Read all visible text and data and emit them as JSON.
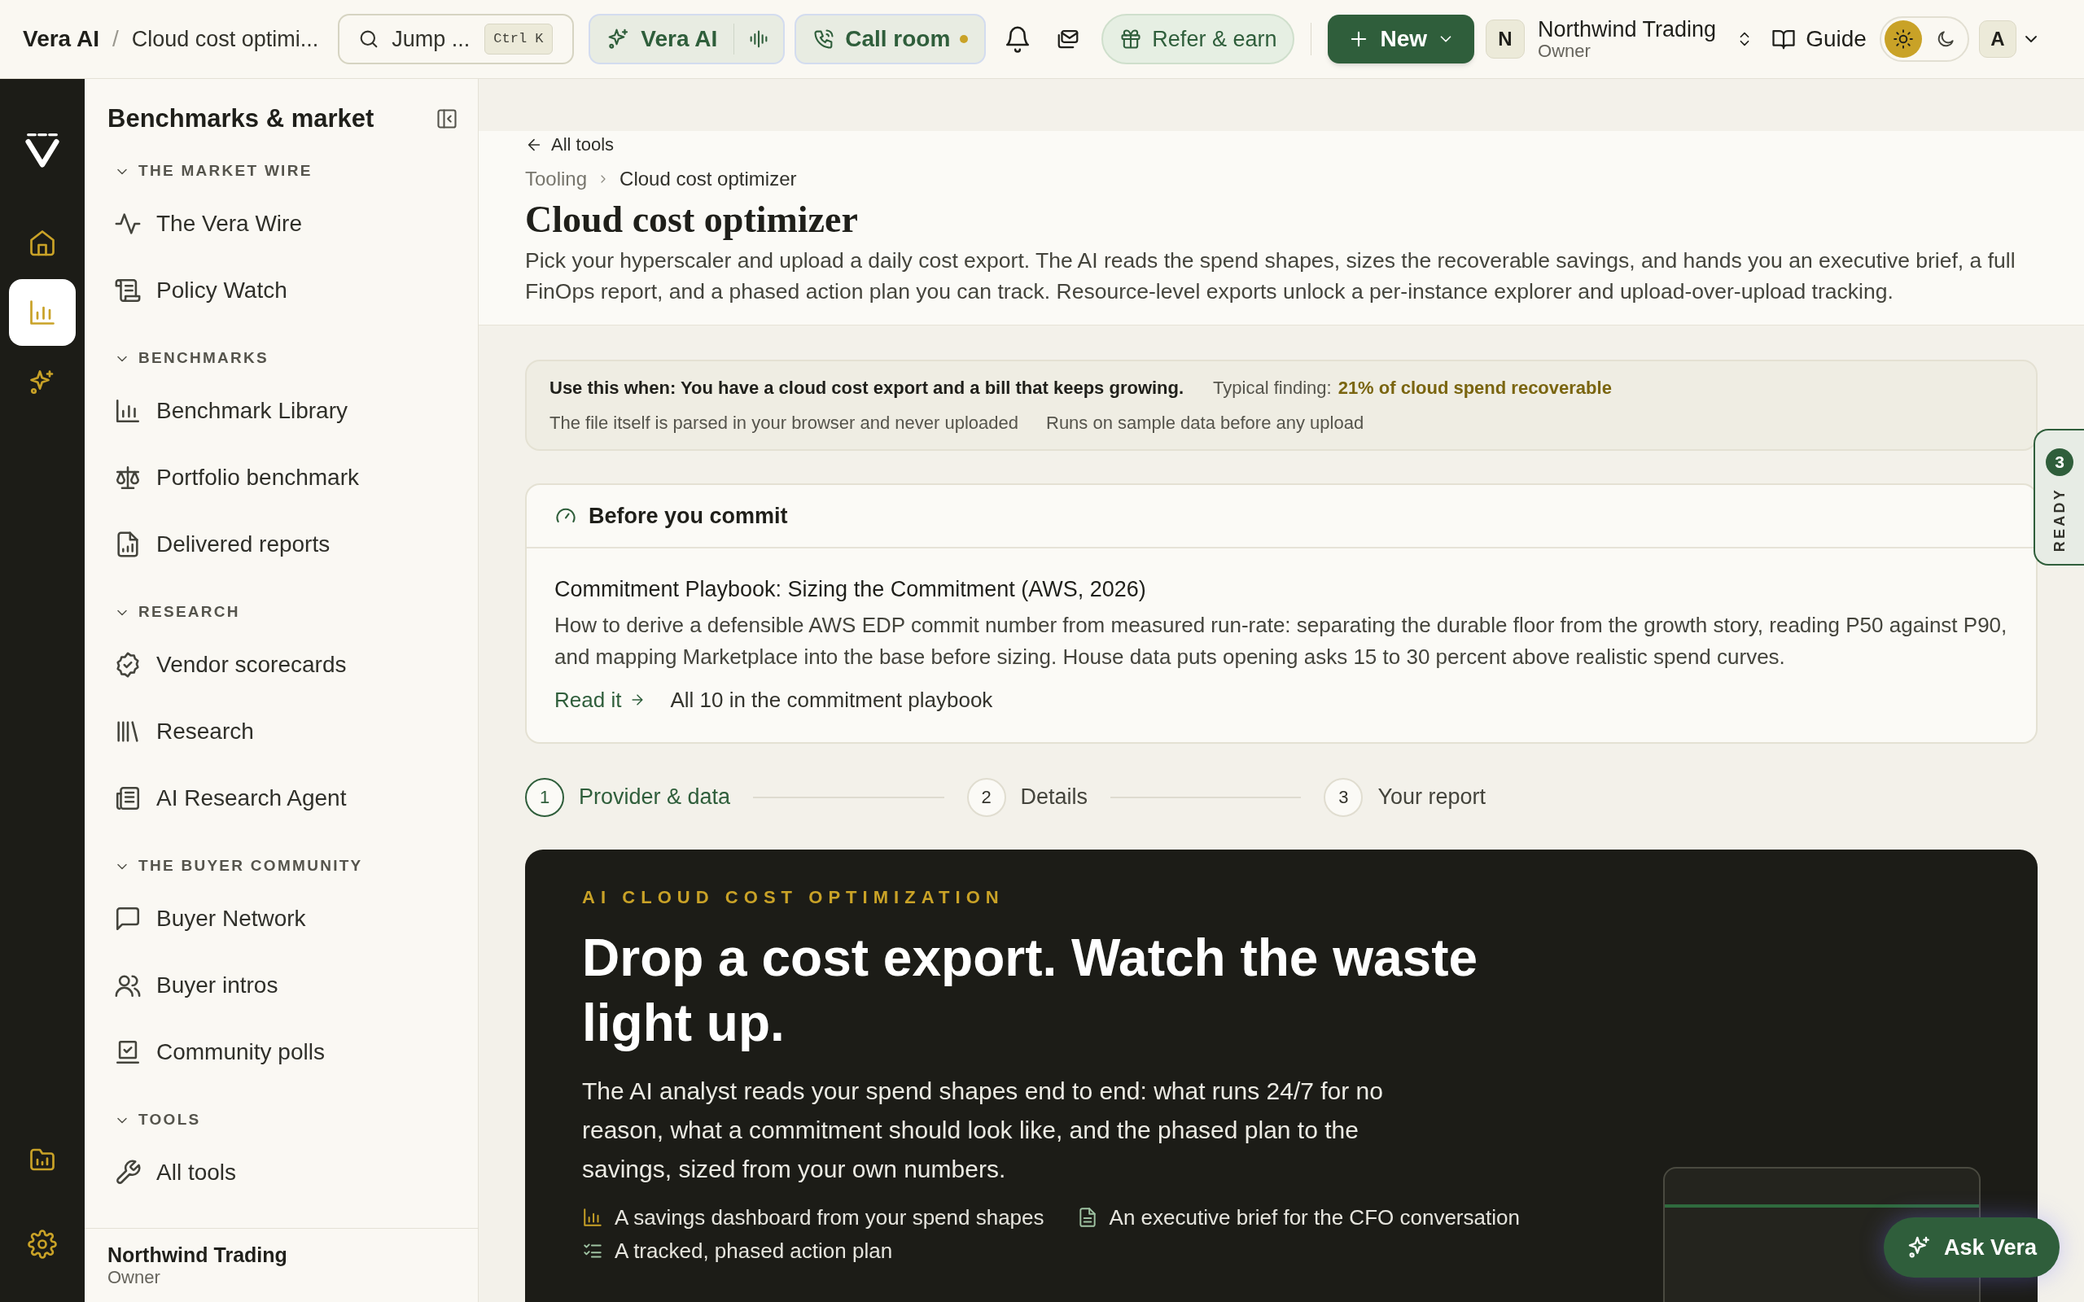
{
  "topbar": {
    "app": "Vera AI",
    "separator": "/",
    "page": "Cloud cost optimi...",
    "search": {
      "placeholder": "Jump ...",
      "shortcut": "Ctrl K"
    },
    "vera_button": "Vera AI",
    "call_button": {
      "label": "Call room",
      "live": true
    },
    "refer_button": "Refer & earn",
    "new_button": "New",
    "workspace": {
      "initial": "N",
      "name": "Northwind Trading",
      "role": "Owner"
    },
    "guide": "Guide",
    "theme": [
      {
        "selected": true
      },
      {
        "selected": false
      }
    ],
    "user_initial": "A"
  },
  "rail": [
    {
      "selected": false
    },
    {
      "selected": true
    },
    {
      "selected": false
    },
    {
      "selected": false
    },
    {
      "selected": false
    }
  ],
  "sidebar": {
    "title": "Benchmarks & market",
    "sections": [
      {
        "heading": "THE MARKET WIRE",
        "expanded": true,
        "items": [
          "The Vera Wire",
          "Policy Watch"
        ]
      },
      {
        "heading": "BENCHMARKS",
        "expanded": true,
        "items": [
          "Benchmark Library",
          "Portfolio benchmark",
          "Delivered reports"
        ]
      },
      {
        "heading": "RESEARCH",
        "expanded": true,
        "items": [
          "Vendor scorecards",
          "Research",
          "AI Research Agent"
        ]
      },
      {
        "heading": "THE BUYER COMMUNITY",
        "expanded": true,
        "items": [
          "Buyer Network",
          "Buyer intros",
          "Community polls"
        ]
      },
      {
        "heading": "TOOLS",
        "expanded": true,
        "items": [
          "All tools"
        ]
      }
    ],
    "footer": {
      "name": "Northwind Trading",
      "role": "Owner"
    }
  },
  "header": {
    "back": "All tools",
    "breadcrumb": [
      "Tooling",
      "Cloud cost optimizer"
    ],
    "title": "Cloud cost optimizer",
    "description": "Pick your hyperscaler and upload a daily cost export. The AI reads the spend shapes, sizes the recoverable savings, and hands you an executive brief, a full FinOps report, and a phased action plan you can track. Resource-level exports unlock a per-instance explorer and upload-over-upload tracking."
  },
  "info": {
    "use_when": "Use this when: You have a cloud cost export and a bill that keeps growing.",
    "finding_label": "Typical finding:",
    "finding": "21% of cloud spend recoverable",
    "notes": [
      "The file itself is parsed in your browser and never uploaded",
      "Runs on sample data before any upload"
    ]
  },
  "commit_card": {
    "title": "Before you commit",
    "article_title": "Commitment Playbook: Sizing the Commitment (AWS, 2026)",
    "article_text": "How to derive a defensible AWS EDP commit number from measured run-rate: separating the durable floor from the growth story, reading P50 against P90, and mapping Marketplace into the base before sizing. House data puts opening asks 15 to 30 percent above realistic spend curves.",
    "read_link": "Read it",
    "all_link": "All 10 in the commitment playbook"
  },
  "steps": [
    {
      "number": "1",
      "label": "Provider & data",
      "selected": true
    },
    {
      "number": "2",
      "label": "Details",
      "selected": false
    },
    {
      "number": "3",
      "label": "Your report",
      "selected": false
    }
  ],
  "hero": {
    "kicker": "AI CLOUD COST OPTIMIZATION",
    "headline": "Drop a cost export. Watch the waste light up.",
    "text": "The AI analyst reads your spend shapes end to end: what runs 24/7 for no reason, what a commitment should look like, and the phased plan to the savings, sized from your own numbers.",
    "features": [
      "A savings dashboard from your spend shapes",
      "An executive brief for the CFO conversation",
      "A tracked, phased action plan"
    ]
  },
  "ready_tab": {
    "count": "3",
    "label": "READY"
  },
  "ask_button": "Ask Vera"
}
